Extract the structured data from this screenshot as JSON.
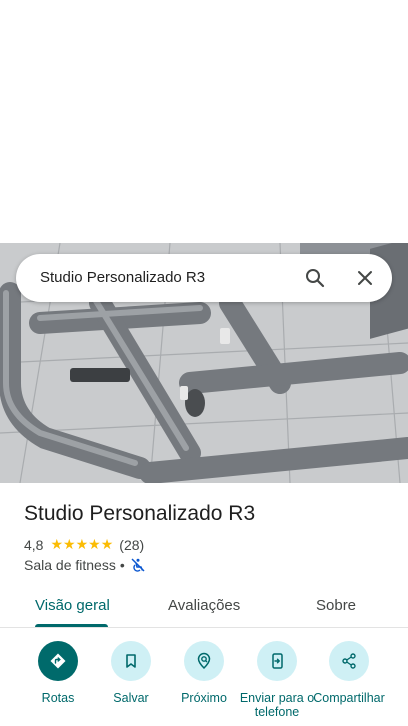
{
  "search": {
    "query": "Studio Personalizado R3"
  },
  "icons": {
    "search": "search-icon",
    "close": "close-icon",
    "accessibility": "no-wheelchair-icon"
  },
  "place": {
    "name": "Studio Personalizado R3",
    "rating": "4,8",
    "stars": 5,
    "review_count": "(28)",
    "category": "Sala de fitness",
    "separator": "•"
  },
  "tabs": [
    {
      "label": "Visão geral",
      "active": true
    },
    {
      "label": "Avaliações",
      "active": false
    },
    {
      "label": "Sobre",
      "active": false
    }
  ],
  "actions": [
    {
      "label": "Rotas",
      "icon": "directions-icon"
    },
    {
      "label": "Salvar",
      "icon": "bookmark-icon"
    },
    {
      "label": "Próximo",
      "icon": "nearby-icon"
    },
    {
      "label": "Enviar para o telefone",
      "icon": "send-to-phone-icon"
    },
    {
      "label": "Compartilhar",
      "icon": "share-icon"
    }
  ],
  "colors": {
    "accent": "#00696b",
    "action_bg": "#cff0f5",
    "star": "#fbbc04"
  }
}
